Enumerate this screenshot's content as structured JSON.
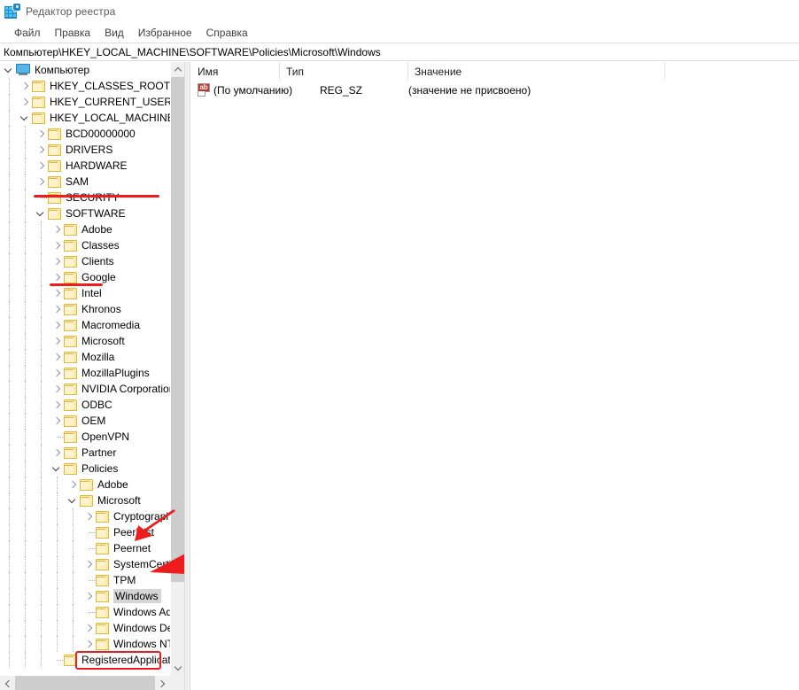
{
  "window": {
    "title": "Редактор реестра",
    "app_icon": "registry-editor-icon"
  },
  "menubar": {
    "items": [
      {
        "label": "Файл"
      },
      {
        "label": "Правка"
      },
      {
        "label": "Вид"
      },
      {
        "label": "Избранное"
      },
      {
        "label": "Справка"
      }
    ]
  },
  "address": {
    "path": "Компьютер\\HKEY_LOCAL_MACHINE\\SOFTWARE\\Policies\\Microsoft\\Windows"
  },
  "tree": {
    "rows": [
      {
        "label": "Компьютер",
        "indent": 0,
        "state": "expanded",
        "icon": "computer-icon"
      },
      {
        "label": "HKEY_CLASSES_ROOT",
        "indent": 1,
        "state": "collapsed",
        "icon": "folder-icon"
      },
      {
        "label": "HKEY_CURRENT_USER",
        "indent": 1,
        "state": "collapsed",
        "icon": "folder-icon"
      },
      {
        "label": "HKEY_LOCAL_MACHINE",
        "indent": 1,
        "state": "expanded",
        "icon": "folder-icon"
      },
      {
        "label": "BCD00000000",
        "indent": 2,
        "state": "collapsed",
        "icon": "folder-icon"
      },
      {
        "label": "DRIVERS",
        "indent": 2,
        "state": "collapsed",
        "icon": "folder-icon"
      },
      {
        "label": "HARDWARE",
        "indent": 2,
        "state": "collapsed",
        "icon": "folder-icon"
      },
      {
        "label": "SAM",
        "indent": 2,
        "state": "collapsed",
        "icon": "folder-icon"
      },
      {
        "label": "SECURITY",
        "indent": 2,
        "state": "leaf",
        "icon": "folder-icon"
      },
      {
        "label": "SOFTWARE",
        "indent": 2,
        "state": "expanded",
        "icon": "folder-icon"
      },
      {
        "label": "Adobe",
        "indent": 3,
        "state": "collapsed",
        "icon": "folder-icon"
      },
      {
        "label": "Classes",
        "indent": 3,
        "state": "collapsed",
        "icon": "folder-icon"
      },
      {
        "label": "Clients",
        "indent": 3,
        "state": "collapsed",
        "icon": "folder-icon"
      },
      {
        "label": "Google",
        "indent": 3,
        "state": "collapsed",
        "icon": "folder-icon"
      },
      {
        "label": "Intel",
        "indent": 3,
        "state": "collapsed",
        "icon": "folder-icon"
      },
      {
        "label": "Khronos",
        "indent": 3,
        "state": "collapsed",
        "icon": "folder-icon"
      },
      {
        "label": "Macromedia",
        "indent": 3,
        "state": "collapsed",
        "icon": "folder-icon"
      },
      {
        "label": "Microsoft",
        "indent": 3,
        "state": "collapsed",
        "icon": "folder-icon"
      },
      {
        "label": "Mozilla",
        "indent": 3,
        "state": "collapsed",
        "icon": "folder-icon"
      },
      {
        "label": "MozillaPlugins",
        "indent": 3,
        "state": "collapsed",
        "icon": "folder-icon"
      },
      {
        "label": "NVIDIA Corporation",
        "indent": 3,
        "state": "collapsed",
        "icon": "folder-icon"
      },
      {
        "label": "ODBC",
        "indent": 3,
        "state": "collapsed",
        "icon": "folder-icon"
      },
      {
        "label": "OEM",
        "indent": 3,
        "state": "collapsed",
        "icon": "folder-icon"
      },
      {
        "label": "OpenVPN",
        "indent": 3,
        "state": "leaf",
        "icon": "folder-icon"
      },
      {
        "label": "Partner",
        "indent": 3,
        "state": "collapsed",
        "icon": "folder-icon"
      },
      {
        "label": "Policies",
        "indent": 3,
        "state": "expanded",
        "icon": "folder-icon"
      },
      {
        "label": "Adobe",
        "indent": 4,
        "state": "collapsed",
        "icon": "folder-icon"
      },
      {
        "label": "Microsoft",
        "indent": 4,
        "state": "expanded",
        "icon": "folder-icon"
      },
      {
        "label": "Cryptography",
        "indent": 5,
        "state": "collapsed",
        "icon": "folder-icon"
      },
      {
        "label": "PeerDist",
        "indent": 5,
        "state": "leaf",
        "icon": "folder-icon"
      },
      {
        "label": "Peernet",
        "indent": 5,
        "state": "leaf",
        "icon": "folder-icon"
      },
      {
        "label": "SystemCertificates",
        "indent": 5,
        "state": "collapsed",
        "icon": "folder-icon"
      },
      {
        "label": "TPM",
        "indent": 5,
        "state": "leaf",
        "icon": "folder-icon"
      },
      {
        "label": "Windows",
        "indent": 5,
        "state": "collapsed",
        "icon": "folder-icon",
        "selected": true
      },
      {
        "label": "Windows Advanced Threat Protection",
        "indent": 5,
        "state": "leaf",
        "icon": "folder-icon"
      },
      {
        "label": "Windows Defender",
        "indent": 5,
        "state": "collapsed",
        "icon": "folder-icon"
      },
      {
        "label": "Windows NT",
        "indent": 5,
        "state": "collapsed",
        "icon": "folder-icon"
      },
      {
        "label": "RegisteredApplications",
        "indent": 3,
        "state": "leaf",
        "icon": "folder-icon"
      }
    ]
  },
  "list": {
    "columns": [
      {
        "label": "Имя"
      },
      {
        "label": "Тип"
      },
      {
        "label": "Значение"
      }
    ],
    "rows": [
      {
        "icon": "string-value-icon",
        "icon_text": "ab",
        "name": "(По умолчанию)",
        "type": "REG_SZ",
        "value": "(значение не присвоено)"
      }
    ]
  },
  "annotations": {
    "accent_color": "#ee1c1c",
    "underlines": [
      {
        "target": "HKEY_LOCAL_MACHINE"
      },
      {
        "target": "SOFTWARE"
      }
    ],
    "arrows": [
      {
        "target": "Policies"
      },
      {
        "target": "Microsoft"
      }
    ],
    "boxes": [
      {
        "target": "Windows"
      }
    ]
  },
  "scrollbars": {
    "vertical_arrow_up": "chevron-up-icon",
    "vertical_arrow_down": "chevron-down-icon",
    "horizontal_arrow_left": "chevron-left-icon",
    "horizontal_arrow_right": "chevron-right-icon"
  }
}
